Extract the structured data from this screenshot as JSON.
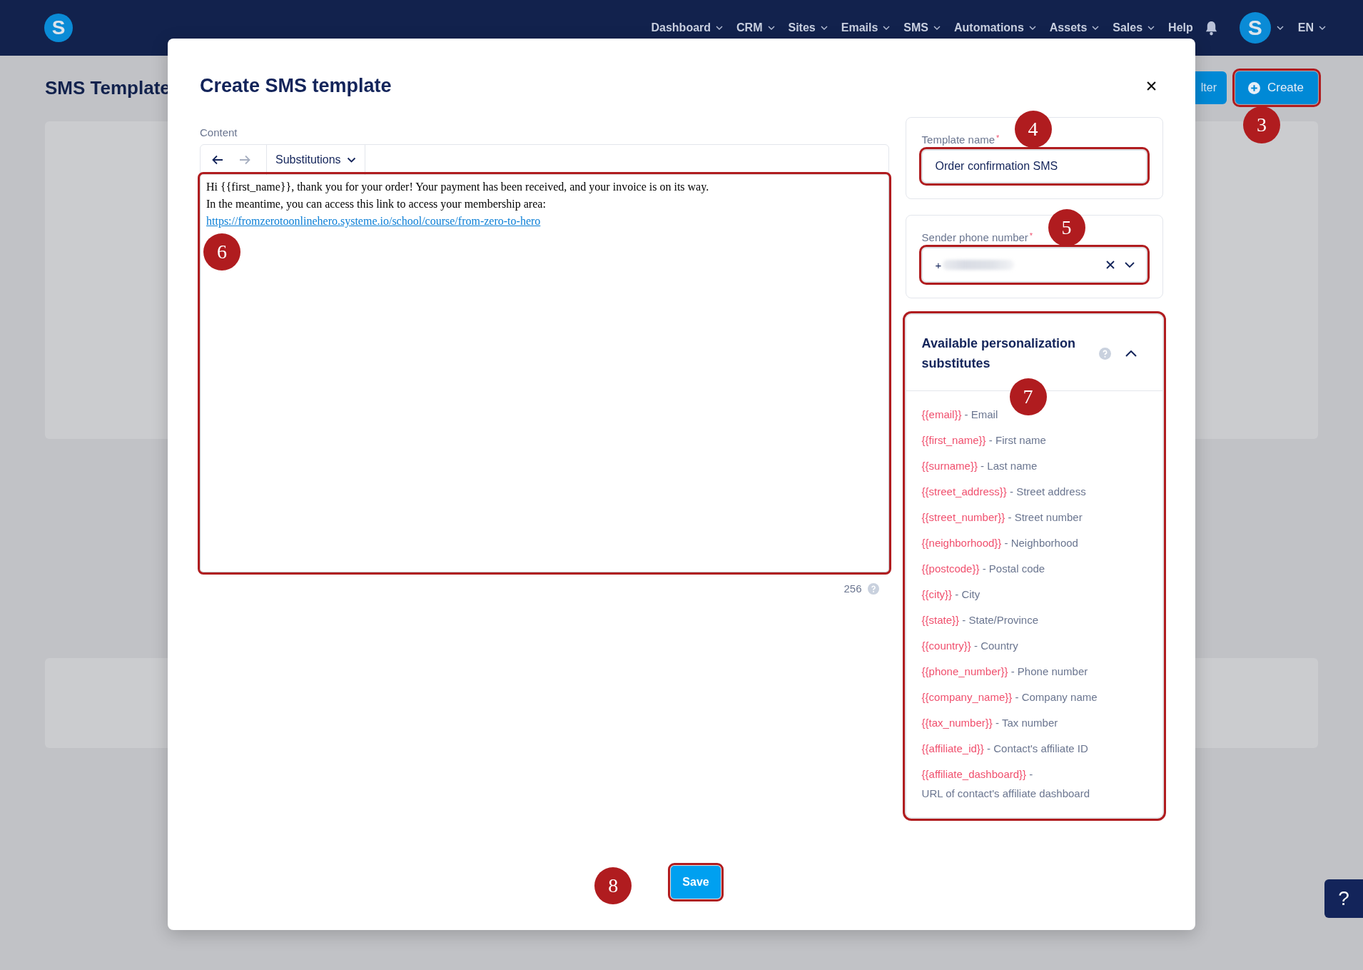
{
  "nav": {
    "logo": "S",
    "items": [
      {
        "label": "Dashboard",
        "dropdown": true
      },
      {
        "label": "CRM",
        "dropdown": true
      },
      {
        "label": "Sites",
        "dropdown": true
      },
      {
        "label": "Emails",
        "dropdown": true
      },
      {
        "label": "SMS",
        "dropdown": true
      },
      {
        "label": "Automations",
        "dropdown": true
      },
      {
        "label": "Assets",
        "dropdown": true
      },
      {
        "label": "Sales",
        "dropdown": true
      },
      {
        "label": "Help",
        "dropdown": false
      }
    ],
    "avatar": "S",
    "language": "EN"
  },
  "page": {
    "title": "SMS Template",
    "filter_button": "lter",
    "create_button": {
      "label": "Create",
      "highlighted": true,
      "marker": "3"
    }
  },
  "modal": {
    "title": "Create SMS template",
    "content": {
      "label": "Content",
      "undo_disabled": false,
      "redo_disabled": true,
      "substitutions": "Substitutions",
      "lines": [
        "Hi {{first_name}}, thank you for your order! Your payment has been received, and your invoice is on its way.",
        "In the meantime, you can access this link to access your membership area:"
      ],
      "link": "https://fromzerotoonlinehero.systeme.io/school/course/from-zero-to-hero",
      "highlighted": true,
      "marker": "6",
      "char_count": "256"
    },
    "template_name": {
      "label": "Template name",
      "required_mark": "*",
      "value": "Order confirmation SMS",
      "highlighted": true,
      "marker": "4"
    },
    "sender_phone": {
      "label": "Sender phone number",
      "required_mark": "*",
      "value": "+",
      "highlighted": true,
      "marker": "5"
    },
    "substitutes": {
      "title": "Available personalization substitutes",
      "expanded": true,
      "highlighted": true,
      "marker": "7",
      "items": [
        {
          "token": "{{email}}",
          "separator": "-",
          "description": "Email"
        },
        {
          "token": "{{first_name}}",
          "separator": "-",
          "description": "First name"
        },
        {
          "token": "{{surname}}",
          "separator": "-",
          "description": "Last name"
        },
        {
          "token": "{{street_address}}",
          "separator": "-",
          "description": "Street address"
        },
        {
          "token": "{{street_number}}",
          "separator": "-",
          "description": "Street number"
        },
        {
          "token": "{{neighborhood}}",
          "separator": "-",
          "description": "Neighborhood"
        },
        {
          "token": "{{postcode}}",
          "separator": "-",
          "description": "Postal code"
        },
        {
          "token": "{{city}}",
          "separator": "-",
          "description": "City"
        },
        {
          "token": "{{state}}",
          "separator": "-",
          "description": "State/Province"
        },
        {
          "token": "{{country}}",
          "separator": "-",
          "description": "Country"
        },
        {
          "token": "{{phone_number}}",
          "separator": "-",
          "description": "Phone number"
        },
        {
          "token": "{{company_name}}",
          "separator": "-",
          "description": "Company name"
        },
        {
          "token": "{{tax_number}}",
          "separator": "-",
          "description": "Tax number"
        },
        {
          "token": "{{affiliate_id}}",
          "separator": "-",
          "description": "Contact's affiliate ID"
        },
        {
          "token": "{{affiliate_dashboard}}",
          "separator": "-",
          "description": "URL of contact's affiliate dashboard"
        }
      ]
    },
    "save_button": {
      "label": "Save",
      "highlighted": true,
      "marker": "8"
    }
  },
  "help_button": "?"
}
